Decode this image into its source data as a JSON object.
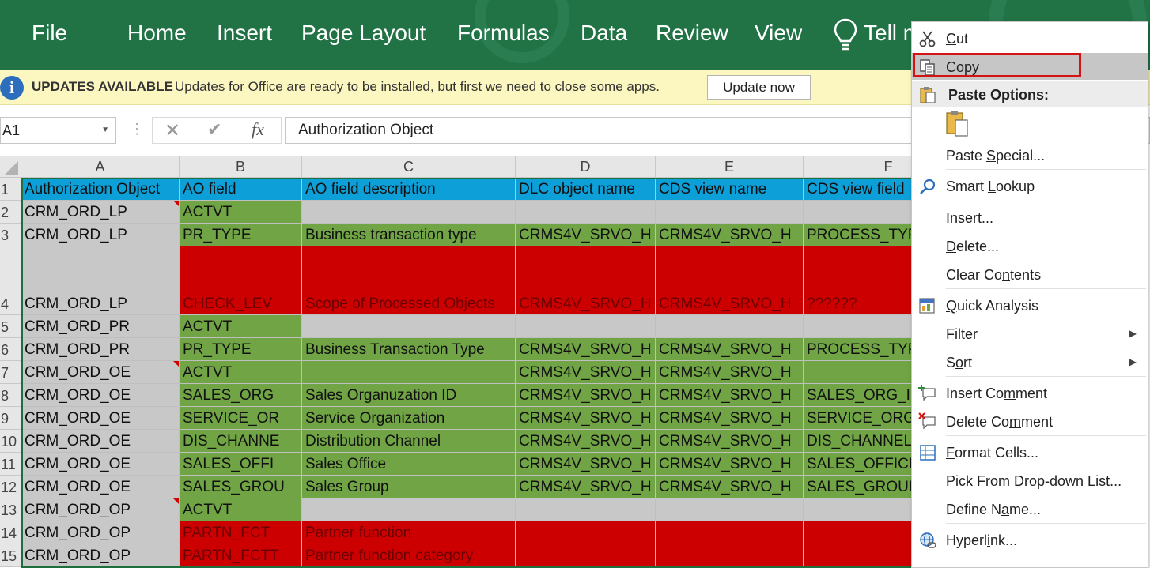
{
  "ribbon": {
    "tabs": [
      "File",
      "Home",
      "Insert",
      "Page Layout",
      "Formulas",
      "Data",
      "Review",
      "View"
    ],
    "tell_me": "Tell m"
  },
  "message_bar": {
    "title": "UPDATES AVAILABLE",
    "text": "Updates for Office are ready to be installed, but first we need to close some apps.",
    "button": "Update now"
  },
  "formula_bar": {
    "name_box": "A1",
    "content": "Authorization Object"
  },
  "grid": {
    "columns": [
      "A",
      "B",
      "C",
      "D",
      "E",
      "F"
    ],
    "rows": [
      {
        "num": "1",
        "cells": [
          "Authorization Object",
          "AO field",
          "AO field description",
          "DLC object name",
          "CDS view name",
          "CDS view field"
        ]
      },
      {
        "num": "2",
        "cells": [
          "CRM_ORD_LP",
          "ACTVT",
          "",
          "",
          "",
          ""
        ]
      },
      {
        "num": "3",
        "cells": [
          "CRM_ORD_LP",
          "PR_TYPE",
          "Business transaction type",
          "CRMS4V_SRVO_H",
          "CRMS4V_SRVO_H",
          "PROCESS_TYPE"
        ]
      },
      {
        "num": "4",
        "cells": [
          "CRM_ORD_LP",
          "CHECK_LEV",
          "Scope of Processed Objects",
          "CRMS4V_SRVO_H",
          "CRMS4V_SRVO_H",
          "??????"
        ]
      },
      {
        "num": "5",
        "cells": [
          "CRM_ORD_PR",
          "ACTVT",
          "",
          "",
          "",
          ""
        ]
      },
      {
        "num": "6",
        "cells": [
          "CRM_ORD_PR",
          "PR_TYPE",
          "Business Transaction Type",
          "CRMS4V_SRVO_H",
          "CRMS4V_SRVO_H",
          "PROCESS_TYPE"
        ]
      },
      {
        "num": "7",
        "cells": [
          "CRM_ORD_OE",
          "ACTVT",
          "",
          "CRMS4V_SRVO_H",
          "CRMS4V_SRVO_H",
          ""
        ]
      },
      {
        "num": "8",
        "cells": [
          "CRM_ORD_OE",
          "SALES_ORG",
          "Sales Organuzation ID",
          "CRMS4V_SRVO_H",
          "CRMS4V_SRVO_H",
          "SALES_ORG_ID"
        ]
      },
      {
        "num": "9",
        "cells": [
          "CRM_ORD_OE",
          "SERVICE_OR",
          "Service Organization",
          "CRMS4V_SRVO_H",
          "CRMS4V_SRVO_H",
          "SERVICE_ORG_"
        ]
      },
      {
        "num": "10",
        "cells": [
          "CRM_ORD_OE",
          "DIS_CHANNE",
          "Distribution Channel",
          "CRMS4V_SRVO_H",
          "CRMS4V_SRVO_H",
          "DIS_CHANNEL"
        ]
      },
      {
        "num": "11",
        "cells": [
          "CRM_ORD_OE",
          "SALES_OFFI",
          "Sales Office",
          "CRMS4V_SRVO_H",
          "CRMS4V_SRVO_H",
          "SALES_OFFICE"
        ]
      },
      {
        "num": "12",
        "cells": [
          "CRM_ORD_OE",
          "SALES_GROU",
          "Sales Group",
          "CRMS4V_SRVO_H",
          "CRMS4V_SRVO_H",
          "SALES_GROUP"
        ]
      },
      {
        "num": "13",
        "cells": [
          "CRM_ORD_OP",
          "ACTVT",
          "",
          "",
          "",
          ""
        ]
      },
      {
        "num": "14",
        "cells": [
          "CRM_ORD_OP",
          "PARTN_FCT",
          "Partner function",
          "",
          "",
          ""
        ]
      },
      {
        "num": "15",
        "cells": [
          "CRM_ORD_OP",
          "PARTN_FCTT",
          "Partner function category",
          "",
          "",
          ""
        ]
      }
    ]
  },
  "context_menu": {
    "items": [
      {
        "label": "Cut",
        "icon": "scissors-icon"
      },
      {
        "label": "Copy",
        "icon": "copy-icon"
      },
      {
        "label": "Paste Options:",
        "icon": "paste-icon"
      },
      {
        "label": "",
        "icon": "clipboard-icon"
      },
      {
        "label": "Paste Special...",
        "icon": ""
      },
      {
        "label": "Smart Lookup",
        "icon": "search-icon"
      },
      {
        "label": "Insert...",
        "icon": ""
      },
      {
        "label": "Delete...",
        "icon": ""
      },
      {
        "label": "Clear Contents",
        "icon": ""
      },
      {
        "label": "Quick Analysis",
        "icon": "quick-analysis-icon"
      },
      {
        "label": "Filter",
        "icon": ""
      },
      {
        "label": "Sort",
        "icon": ""
      },
      {
        "label": "Insert Comment",
        "icon": "insert-comment-icon"
      },
      {
        "label": "Delete Comment",
        "icon": "delete-comment-icon"
      },
      {
        "label": "Format Cells...",
        "icon": "format-cells-icon"
      },
      {
        "label": "Pick From Drop-down List...",
        "icon": ""
      },
      {
        "label": "Define Name...",
        "icon": ""
      },
      {
        "label": "Hyperlink...",
        "icon": "hyperlink-icon"
      }
    ]
  },
  "colors": {
    "ribbon": "#217346",
    "header_blue": "#0da0d8",
    "green": "#70a444",
    "red": "#cc0000",
    "gray": "#c8c8c8",
    "highlight_box": "#d41414"
  }
}
